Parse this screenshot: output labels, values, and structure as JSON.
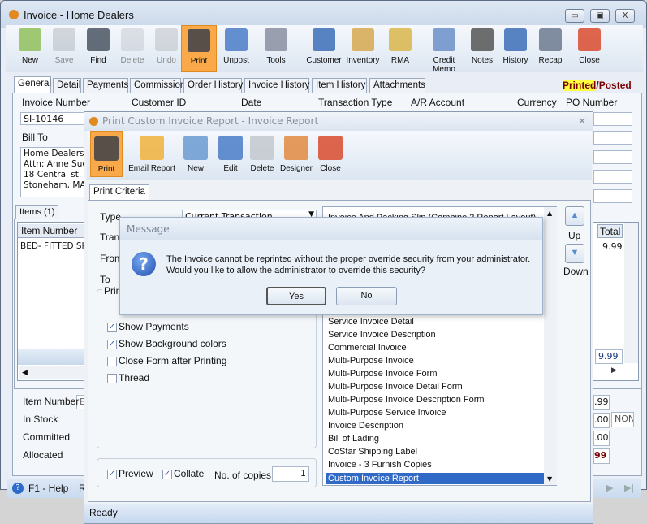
{
  "window": {
    "title": "Invoice - Home Dealers",
    "minimize": "▭",
    "maximize": "▣",
    "close": "X"
  },
  "toolbar": [
    {
      "label": "New",
      "icon": "new-icon"
    },
    {
      "label": "Save",
      "icon": "save-icon",
      "disabled": true
    },
    {
      "label": "Find",
      "icon": "binoculars-icon"
    },
    {
      "label": "Delete",
      "icon": "recycle-bin-icon",
      "disabled": true
    },
    {
      "label": "Undo",
      "icon": "undo-icon",
      "disabled": true
    },
    {
      "label": "Print",
      "icon": "printer-icon",
      "active": true
    },
    {
      "label": "Unpost",
      "icon": "unpost-icon"
    },
    {
      "label": "Tools",
      "icon": "tools-icon"
    },
    {
      "label": "Customer",
      "icon": "customer-icon"
    },
    {
      "label": "Inventory",
      "icon": "boxes-icon"
    },
    {
      "label": "RMA",
      "icon": "rma-icon"
    },
    {
      "label": "Credit Memo",
      "icon": "credit-memo-icon"
    },
    {
      "label": "Notes",
      "icon": "notes-icon"
    },
    {
      "label": "History",
      "icon": "history-icon"
    },
    {
      "label": "Recap",
      "icon": "recap-icon"
    },
    {
      "label": "Close",
      "icon": "close-icon"
    }
  ],
  "tabs": [
    "General",
    "Detail",
    "Payments",
    "Commission",
    "Order History",
    "Invoice History",
    "Item History",
    "Attachments"
  ],
  "status": {
    "printed": "Printed",
    "sep": "/",
    "posted": "Posted"
  },
  "fields": {
    "labels": [
      "Invoice Number",
      "Customer ID",
      "Date",
      "Transaction Type",
      "A/R Account",
      "Currency",
      "PO Number"
    ],
    "invoice_number": "SI-10146",
    "bill_to_label": "Bill To",
    "bill_to": [
      "Home Dealers",
      "Attn: Anne Sue",
      "18 Central st.",
      "Stoneham, MA 0"
    ]
  },
  "items": {
    "tab": "Items (1)",
    "col_item": "Item Number",
    "col_total": "Total",
    "row_item": "BED- FITTED SH",
    "row_total": "9.99",
    "sum_total": "9.99"
  },
  "detail": {
    "labels": [
      "Item Number",
      "In Stock",
      "Committed",
      "Allocated"
    ],
    "item_prefix": "B",
    "values": [
      ".99",
      ".00",
      ".00",
      "99"
    ],
    "non": "NON"
  },
  "footer": {
    "help": "F1 - Help",
    "r": "R"
  },
  "dialog": {
    "title": "Print Custom Invoice Report - Invoice Report",
    "toolbar": [
      {
        "label": "Print",
        "icon": "printer-icon"
      },
      {
        "label": "Email Report",
        "icon": "email-icon"
      },
      {
        "label": "New",
        "icon": "new-report-icon"
      },
      {
        "label": "Edit",
        "icon": "edit-icon"
      },
      {
        "label": "Delete",
        "icon": "recycle-bin-icon"
      },
      {
        "label": "Designer",
        "icon": "designer-icon"
      },
      {
        "label": "Close",
        "icon": "close-icon"
      }
    ],
    "tab": "Print Criteria",
    "labels": {
      "type": "Type",
      "trans": "Trans",
      "from": "From",
      "to": "To",
      "print_group": "Prin"
    },
    "type_value": "Current Transaction",
    "options": [
      {
        "label": "Show Payments",
        "checked": true
      },
      {
        "label": "Show Background colors",
        "checked": true
      },
      {
        "label": "Close Form after Printing",
        "checked": false
      },
      {
        "label": "Thread",
        "checked": false
      }
    ],
    "preview": "Preview",
    "collate": "Collate",
    "copies_label": "No. of copies",
    "copies": "1",
    "reports_first": "Invoice And Packing Slip (Combine 2 Report Layout)",
    "reports": [
      "Service Invoice Detail",
      "Service Invoice Description",
      "Commercial Invoice",
      "Multi-Purpose Invoice",
      "Multi-Purpose Invoice Form",
      "Multi-Purpose Invoice Detail Form",
      "Multi-Purpose Invoice Description Form",
      "Multi-Purpose Service Invoice",
      "Invoice Description",
      "Bill of Lading",
      "CoStar Shipping Label",
      "Invoice - 3 Furnish Copies",
      "Custom Invoice Report"
    ],
    "selected": "Custom Invoice Report",
    "up": "Up",
    "down": "Down",
    "status": "Ready"
  },
  "message": {
    "title": "Message",
    "line1": "The Invoice cannot be reprinted without the proper override security from your administrator.",
    "line2": "Would you like to allow the administrator to override this security?",
    "yes": "Yes",
    "no": "No"
  },
  "colors": {
    "accent": "#f9a84a",
    "selection": "#3169c6",
    "posted": "#7a0000",
    "printed_bg": "#ffff40"
  }
}
